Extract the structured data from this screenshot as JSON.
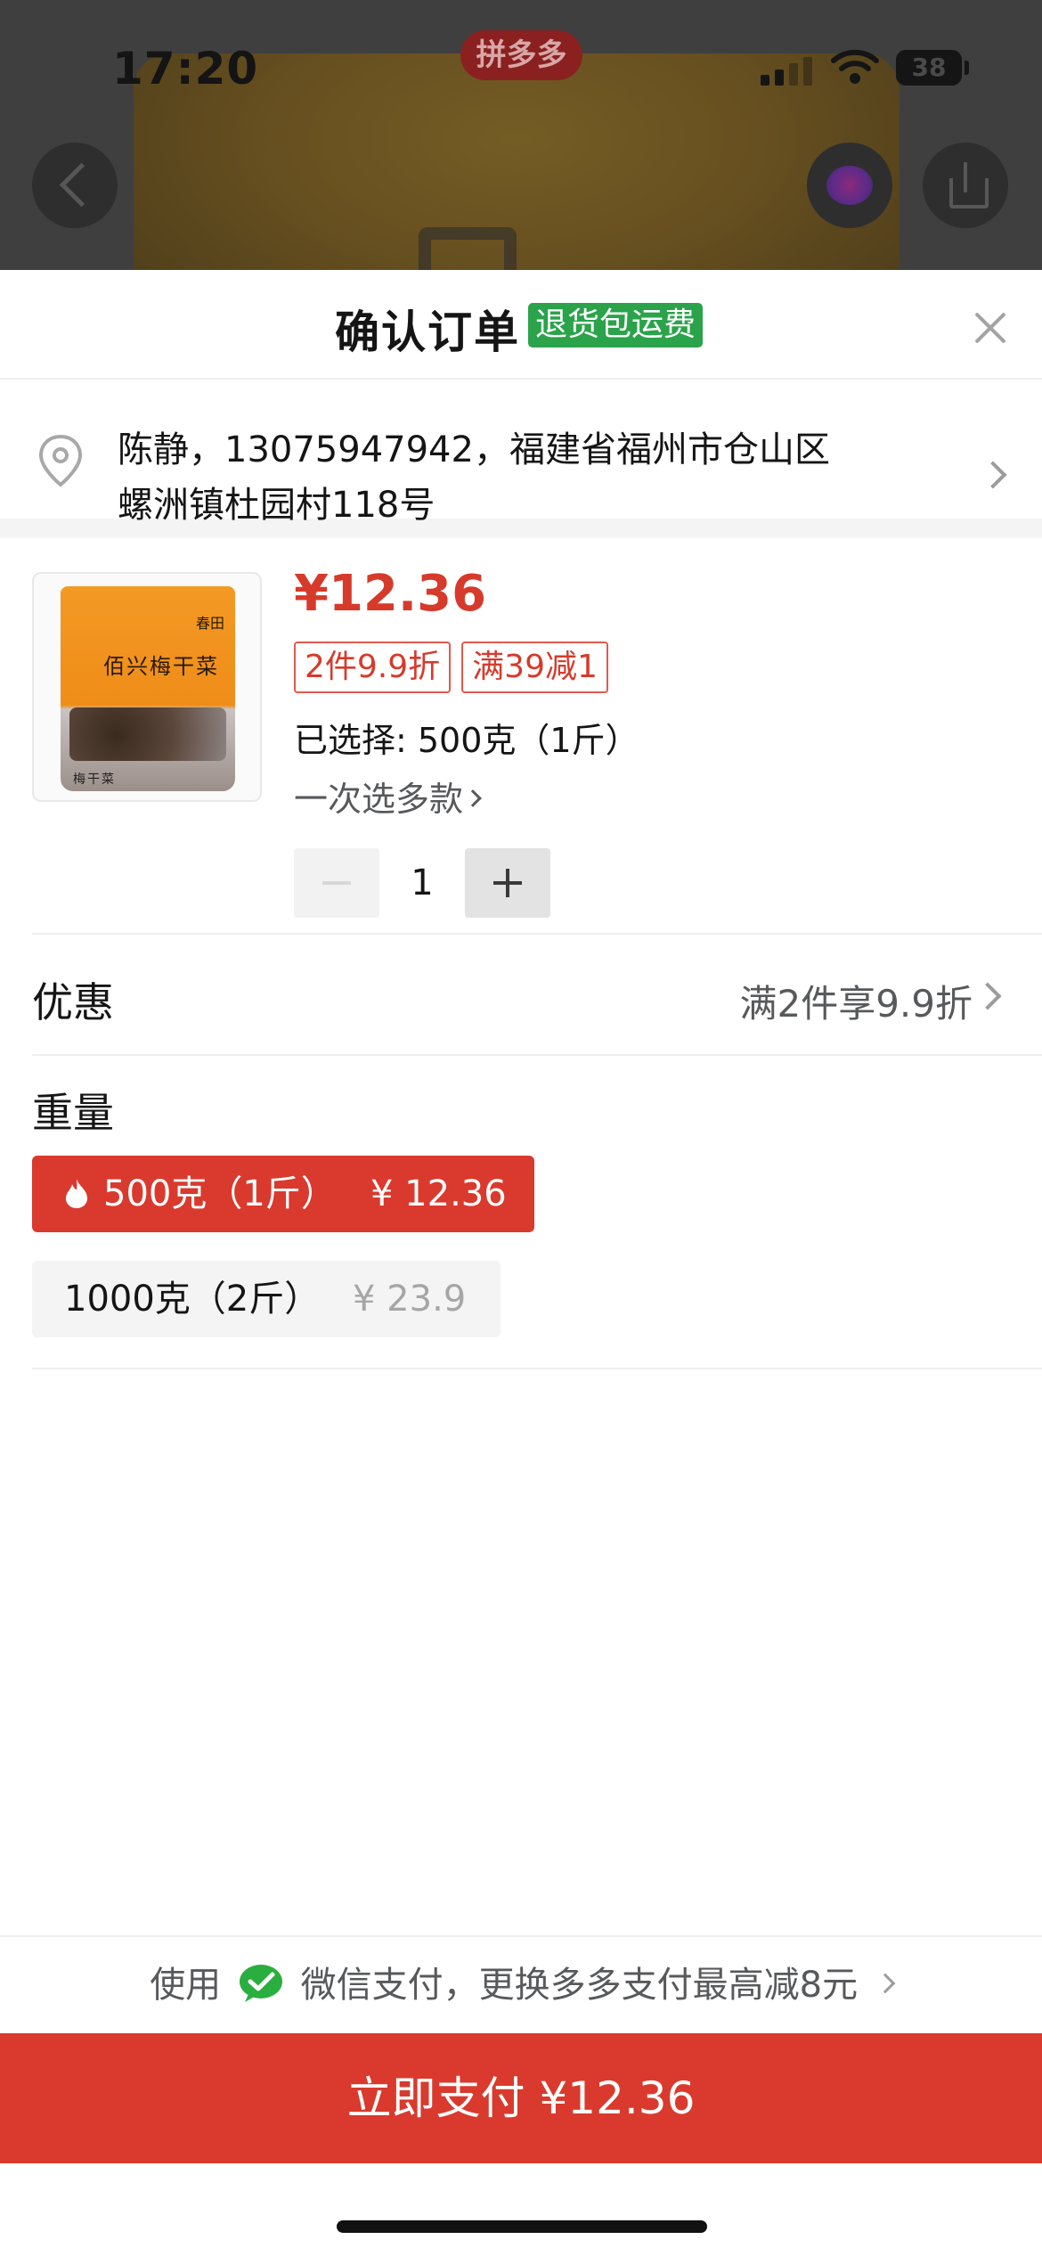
{
  "status_bar": {
    "time": "17:20",
    "battery": "38",
    "app_badge": "拼多多"
  },
  "sheet": {
    "title": "确认订单",
    "badge": "退货包运费"
  },
  "address": {
    "line1": "陈静，13075947942，福建省福州市仓山区",
    "line2": "螺洲镇杜园村118号"
  },
  "product": {
    "price": "¥12.36",
    "tags": [
      "2件9.9折",
      "满39减1"
    ],
    "selected": "已选择: 500克（1斤）",
    "multi_select": "一次选多款",
    "quantity": "1"
  },
  "promo": {
    "label": "优惠",
    "value": "满2件享9.9折"
  },
  "spec": {
    "label": "重量",
    "options": [
      {
        "name": "500克（1斤）",
        "price": "¥ 12.36",
        "selected": true
      },
      {
        "name": "1000克（2斤）",
        "price": "¥ 23.9",
        "selected": false
      }
    ]
  },
  "payment": {
    "hint_prefix": "使用",
    "hint_suffix": "微信支付，更换多多支付最高减8元",
    "button": "立即支付 ¥12.36"
  },
  "colors": {
    "accent": "#d93a2d",
    "badge_green": "#2aa34a"
  }
}
